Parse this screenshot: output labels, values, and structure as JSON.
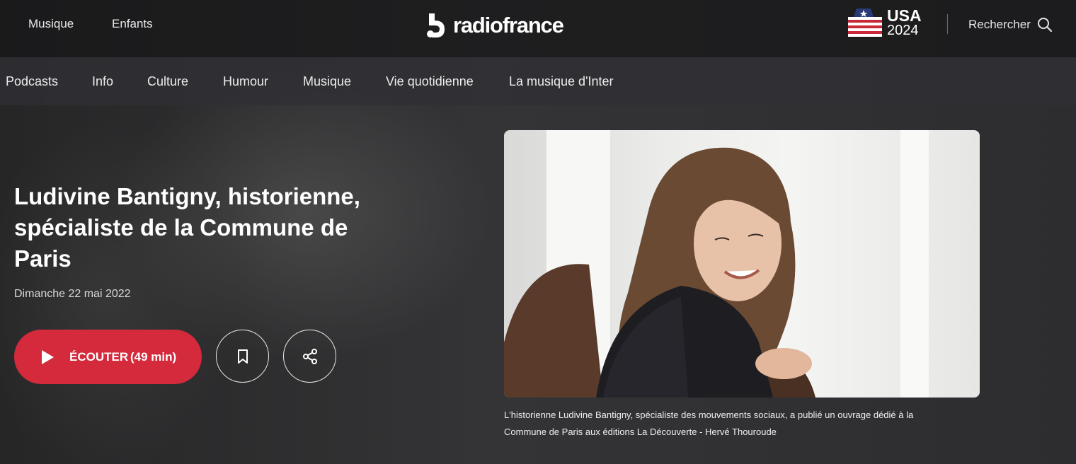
{
  "top_nav": {
    "links": [
      "Musique",
      "Enfants"
    ],
    "brand": "radiofrance",
    "usa_badge": {
      "title": "USA",
      "year": "2024"
    },
    "search_label": "Rechercher"
  },
  "main_nav": {
    "items": [
      "Podcasts",
      "Info",
      "Culture",
      "Humour",
      "Musique",
      "Vie quotidienne",
      "La musique d'Inter"
    ]
  },
  "episode": {
    "title": "Ludivine Bantigny, historienne, spécialiste de la Commune de Paris",
    "date": "Dimanche 22 mai 2022",
    "listen_label": "ÉCOUTER",
    "duration": "(49 min)",
    "photo_caption": "L'historienne Ludivine Bantigny, spécialiste des mouvements sociaux, a publié un ouvrage dédié à la Commune de Paris aux éditions La Découverte - Hervé Thouroude"
  },
  "colors": {
    "accent_red": "#d42a3b",
    "topbar_bg": "#161618",
    "navbar_bg": "#303034"
  },
  "icons": {
    "search": "search-icon",
    "play": "play-icon",
    "bookmark": "bookmark-icon",
    "share": "share-icon",
    "logo": "radiofrance-logo-icon",
    "flag": "usa-flag-icon"
  }
}
